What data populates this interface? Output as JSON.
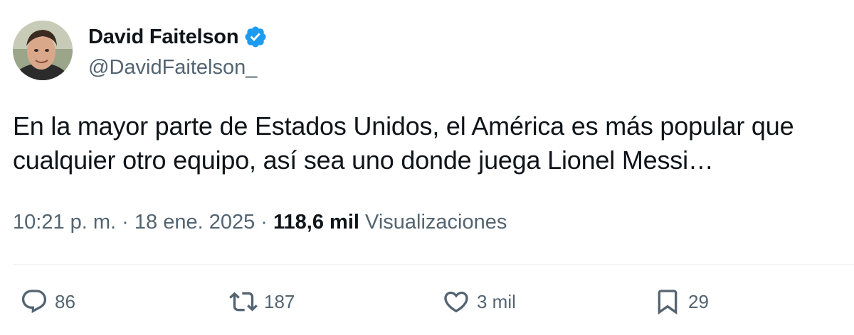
{
  "author": {
    "display_name": "David Faitelson",
    "handle": "@DavidFaitelson_",
    "verified": true
  },
  "tweet": {
    "text": "En la mayor parte de Estados Unidos, el América es más popular que\ncualquier otro equipo, así sea uno donde juega Lionel Messi…",
    "time": "10:21 p. m.",
    "separator": "·",
    "date": "18 ene. 2025",
    "views_count": "118,6 mil",
    "views_label": "Visualizaciones"
  },
  "actions": {
    "replies": "86",
    "retweets": "187",
    "likes": "3 mil",
    "bookmarks": "29"
  },
  "icons": {
    "verified": "verified-badge-icon",
    "reply": "reply-icon",
    "retweet": "retweet-icon",
    "like": "heart-icon",
    "bookmark": "bookmark-icon"
  },
  "colors": {
    "verified_blue": "#1d9bf0",
    "secondary_text": "#536471",
    "primary_text": "#0f1419"
  }
}
